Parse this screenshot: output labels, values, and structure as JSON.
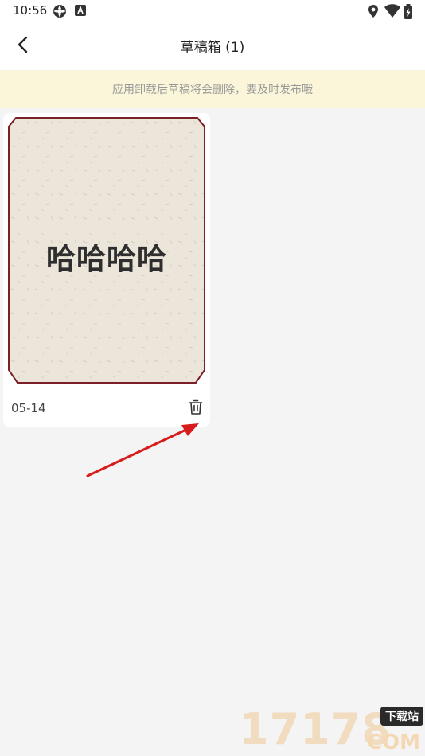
{
  "status_bar": {
    "time": "10:56",
    "left_icons": [
      "sync-icon",
      "a-icon"
    ],
    "right_icons": [
      "location-icon",
      "wifi-icon",
      "battery-icon"
    ]
  },
  "header": {
    "title": "草稿箱 (1)",
    "back_icon": "back-chevron-icon"
  },
  "notice": {
    "text": "应用卸载后草稿将会删除，要及时发布哦"
  },
  "drafts": [
    {
      "cover_text": "哈哈哈哈",
      "date": "05-14",
      "delete_icon": "trash-icon"
    }
  ],
  "watermark": {
    "digits": "17178",
    "badge": "下载站",
    "domain": "COM"
  },
  "colors": {
    "notice_bg": "#fbf6d9",
    "cover_border": "#7a1f25",
    "cover_paper": "#ece6da",
    "arrow": "#d81b1b"
  }
}
